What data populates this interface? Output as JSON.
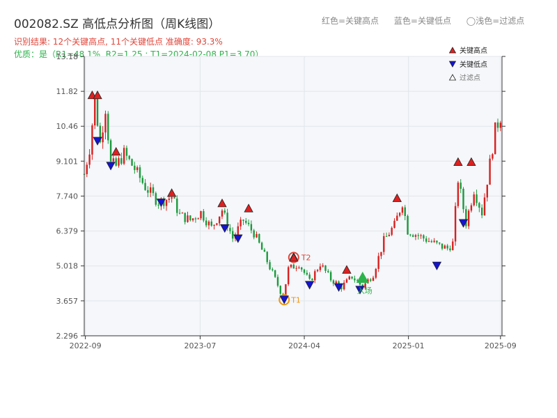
{
  "header": {
    "title": "002082.SZ 高低点分析图（周K线图）",
    "legend_red": "红色=关键高点",
    "legend_blue": "蓝色=关键低点",
    "legend_light": "◯浅色=过滤点",
    "result_line": "识别结果: 12个关键高点, 11个关键低点  准确度: 93.3%",
    "quality_line": "优质：是（R1=48.1%, R2=1.25 ; T1=2024-02-08 P1=3.70）"
  },
  "colors": {
    "up": "#d91f1f",
    "down": "#1a9a3c",
    "high_marker": "#e02020",
    "low_marker": "#1414d2",
    "t1": "#f0960f",
    "t2": "#e0463a",
    "entry": "#2db34b",
    "plot_bg": "#f5f7fa"
  },
  "chart_data": {
    "type": "candlestick",
    "x_ticks": [
      "2022-09",
      "2023-07",
      "2024-04",
      "2025-01",
      "2025-09"
    ],
    "x_tick_positions": [
      "2022-09-01",
      "2023-07-01",
      "2024-04-01",
      "2025-01-01",
      "2025-09-01"
    ],
    "y_ticks": [
      "2.296",
      "3.657",
      "5.018",
      "6.379",
      "7.740",
      "9.101",
      "10.46",
      "11.82",
      "13.18"
    ],
    "ylim": [
      2.296,
      13.18
    ],
    "xlim": [
      "2022-08-29",
      "2025-09-05"
    ],
    "grid": true,
    "close_path": [
      [
        "2022-08-29",
        8.6
      ],
      [
        "2022-09-12",
        9.6
      ],
      [
        "2022-09-26",
        11.5
      ],
      [
        "2022-10-10",
        9.8
      ],
      [
        "2022-10-24",
        11.2
      ],
      [
        "2022-11-07",
        9.0
      ],
      [
        "2022-11-21",
        8.9
      ],
      [
        "2022-12-12",
        9.4
      ],
      [
        "2023-01-09",
        8.8
      ],
      [
        "2023-02-06",
        8.1
      ],
      [
        "2023-03-13",
        7.5
      ],
      [
        "2023-04-17",
        7.7
      ],
      [
        "2023-05-08",
        7.0
      ],
      [
        "2023-06-05",
        6.8
      ],
      [
        "2023-07-03",
        7.1
      ],
      [
        "2023-07-31",
        6.5
      ],
      [
        "2023-08-28",
        7.2
      ],
      [
        "2023-09-25",
        6.1
      ],
      [
        "2023-10-23",
        6.8
      ],
      [
        "2023-11-20",
        6.3
      ],
      [
        "2023-12-25",
        5.2
      ],
      [
        "2024-02-05",
        3.8
      ],
      [
        "2024-02-19",
        4.9
      ],
      [
        "2024-03-18",
        5.1
      ],
      [
        "2024-04-15",
        4.4
      ],
      [
        "2024-05-13",
        5.1
      ],
      [
        "2024-06-10",
        4.5
      ],
      [
        "2024-07-08",
        4.2
      ],
      [
        "2024-08-05",
        4.6
      ],
      [
        "2024-09-02",
        4.2
      ],
      [
        "2024-09-30",
        4.7
      ],
      [
        "2024-10-28",
        6.0
      ],
      [
        "2024-11-25",
        6.6
      ],
      [
        "2024-12-16",
        7.5
      ],
      [
        "2024-12-30",
        6.4
      ],
      [
        "2025-02-10",
        6.1
      ],
      [
        "2025-03-24",
        5.8
      ],
      [
        "2025-04-14",
        5.7
      ],
      [
        "2025-04-28",
        5.9
      ],
      [
        "2025-05-12",
        8.4
      ],
      [
        "2025-06-02",
        6.7
      ],
      [
        "2025-06-23",
        8.0
      ],
      [
        "2025-07-14",
        7.1
      ],
      [
        "2025-08-04",
        9.0
      ],
      [
        "2025-08-18",
        10.3
      ],
      [
        "2025-09-05",
        11.0
      ]
    ],
    "key_highs": [
      {
        "date": "2022-09-19",
        "price": 11.68
      },
      {
        "date": "2022-10-03",
        "price": 11.68
      },
      {
        "date": "2022-11-21",
        "price": 9.48
      },
      {
        "date": "2023-04-17",
        "price": 7.87
      },
      {
        "date": "2023-08-28",
        "price": 7.47
      },
      {
        "date": "2023-11-06",
        "price": 7.27
      },
      {
        "date": "2024-03-04",
        "price": 5.38
      },
      {
        "date": "2024-07-22",
        "price": 4.88
      },
      {
        "date": "2024-12-02",
        "price": 7.67
      },
      {
        "date": "2025-05-12",
        "price": 9.08
      },
      {
        "date": "2025-06-16",
        "price": 9.08
      }
    ],
    "key_lows": [
      {
        "date": "2022-10-03",
        "price": 9.88
      },
      {
        "date": "2022-11-07",
        "price": 8.91
      },
      {
        "date": "2023-03-20",
        "price": 7.48
      },
      {
        "date": "2023-09-04",
        "price": 6.48
      },
      {
        "date": "2023-10-09",
        "price": 6.08
      },
      {
        "date": "2024-04-15",
        "price": 4.27
      },
      {
        "date": "2024-07-01",
        "price": 4.18
      },
      {
        "date": "2024-08-26",
        "price": 4.08
      },
      {
        "date": "2025-03-17",
        "price": 5.02
      },
      {
        "date": "2025-05-26",
        "price": 6.68
      }
    ],
    "t1": {
      "label": "T1",
      "date": "2024-02-08",
      "price": 3.7
    },
    "t2": {
      "label": "T2",
      "date": "2024-03-04",
      "price": 5.35
    },
    "entry": {
      "label": "入场",
      "date": "2024-09-02",
      "price": 4.55
    },
    "legend": [
      "关键高点",
      "关键低点",
      "过滤点"
    ]
  }
}
